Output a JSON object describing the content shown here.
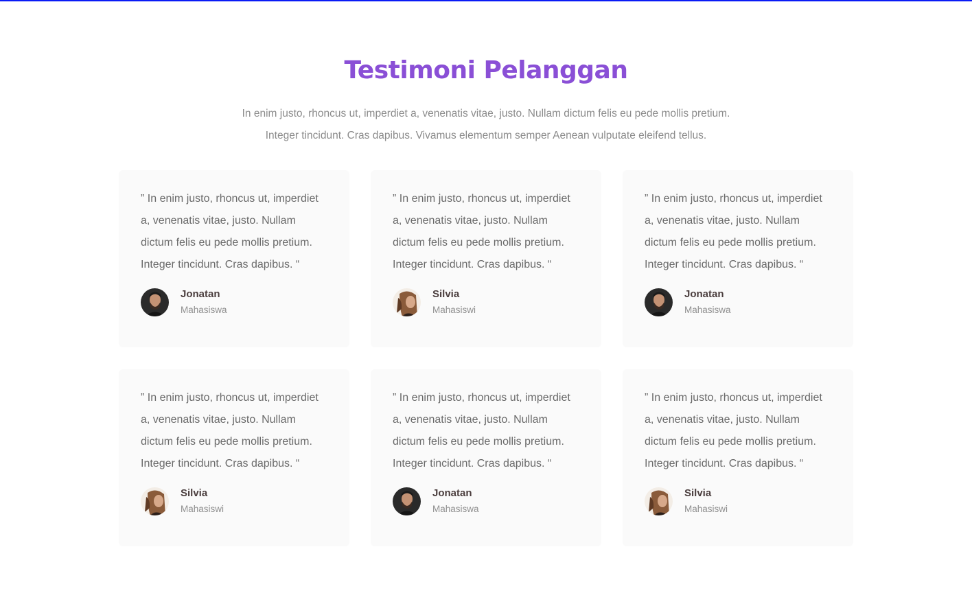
{
  "section": {
    "title": "Testimoni Pelanggan",
    "subtitle_line1": "In enim justo, rhoncus ut, imperdiet a, venenatis vitae, justo. Nullam dictum felis eu pede mollis pretium.",
    "subtitle_line2": "Integer tincidunt. Cras dapibus. Vivamus elementum semper Aenean vulputate eleifend tellus.",
    "accent_color": "#8a4fd6",
    "top_border_color": "#0a1bf5"
  },
  "testimonials": [
    {
      "quote": "” In enim justo, rhoncus ut, imperdiet a, venenatis vitae, justo. Nullam dictum felis eu pede mollis pretium. Integer tincidunt. Cras dapibus. “",
      "name": "Jonatan",
      "role": "Mahasiswa",
      "avatar_icon": "man-avatar-icon"
    },
    {
      "quote": "” In enim justo, rhoncus ut, imperdiet a, venenatis vitae, justo. Nullam dictum felis eu pede mollis pretium. Integer tincidunt. Cras dapibus. “",
      "name": "Silvia",
      "role": "Mahasiswi",
      "avatar_icon": "woman-avatar-icon"
    },
    {
      "quote": "” In enim justo, rhoncus ut, imperdiet a, venenatis vitae, justo. Nullam dictum felis eu pede mollis pretium. Integer tincidunt. Cras dapibus. “",
      "name": "Jonatan",
      "role": "Mahasiswa",
      "avatar_icon": "man-avatar-icon"
    },
    {
      "quote": "” In enim justo, rhoncus ut, imperdiet a, venenatis vitae, justo. Nullam dictum felis eu pede mollis pretium. Integer tincidunt. Cras dapibus. “",
      "name": "Silvia",
      "role": "Mahasiswi",
      "avatar_icon": "woman-avatar-icon"
    },
    {
      "quote": "” In enim justo, rhoncus ut, imperdiet a, venenatis vitae, justo. Nullam dictum felis eu pede mollis pretium. Integer tincidunt. Cras dapibus. “",
      "name": "Jonatan",
      "role": "Mahasiswa",
      "avatar_icon": "man-avatar-icon"
    },
    {
      "quote": "” In enim justo, rhoncus ut, imperdiet a, venenatis vitae, justo. Nullam dictum felis eu pede mollis pretium. Integer tincidunt. Cras dapibus. “",
      "name": "Silvia",
      "role": "Mahasiswi",
      "avatar_icon": "woman-avatar-icon"
    }
  ]
}
